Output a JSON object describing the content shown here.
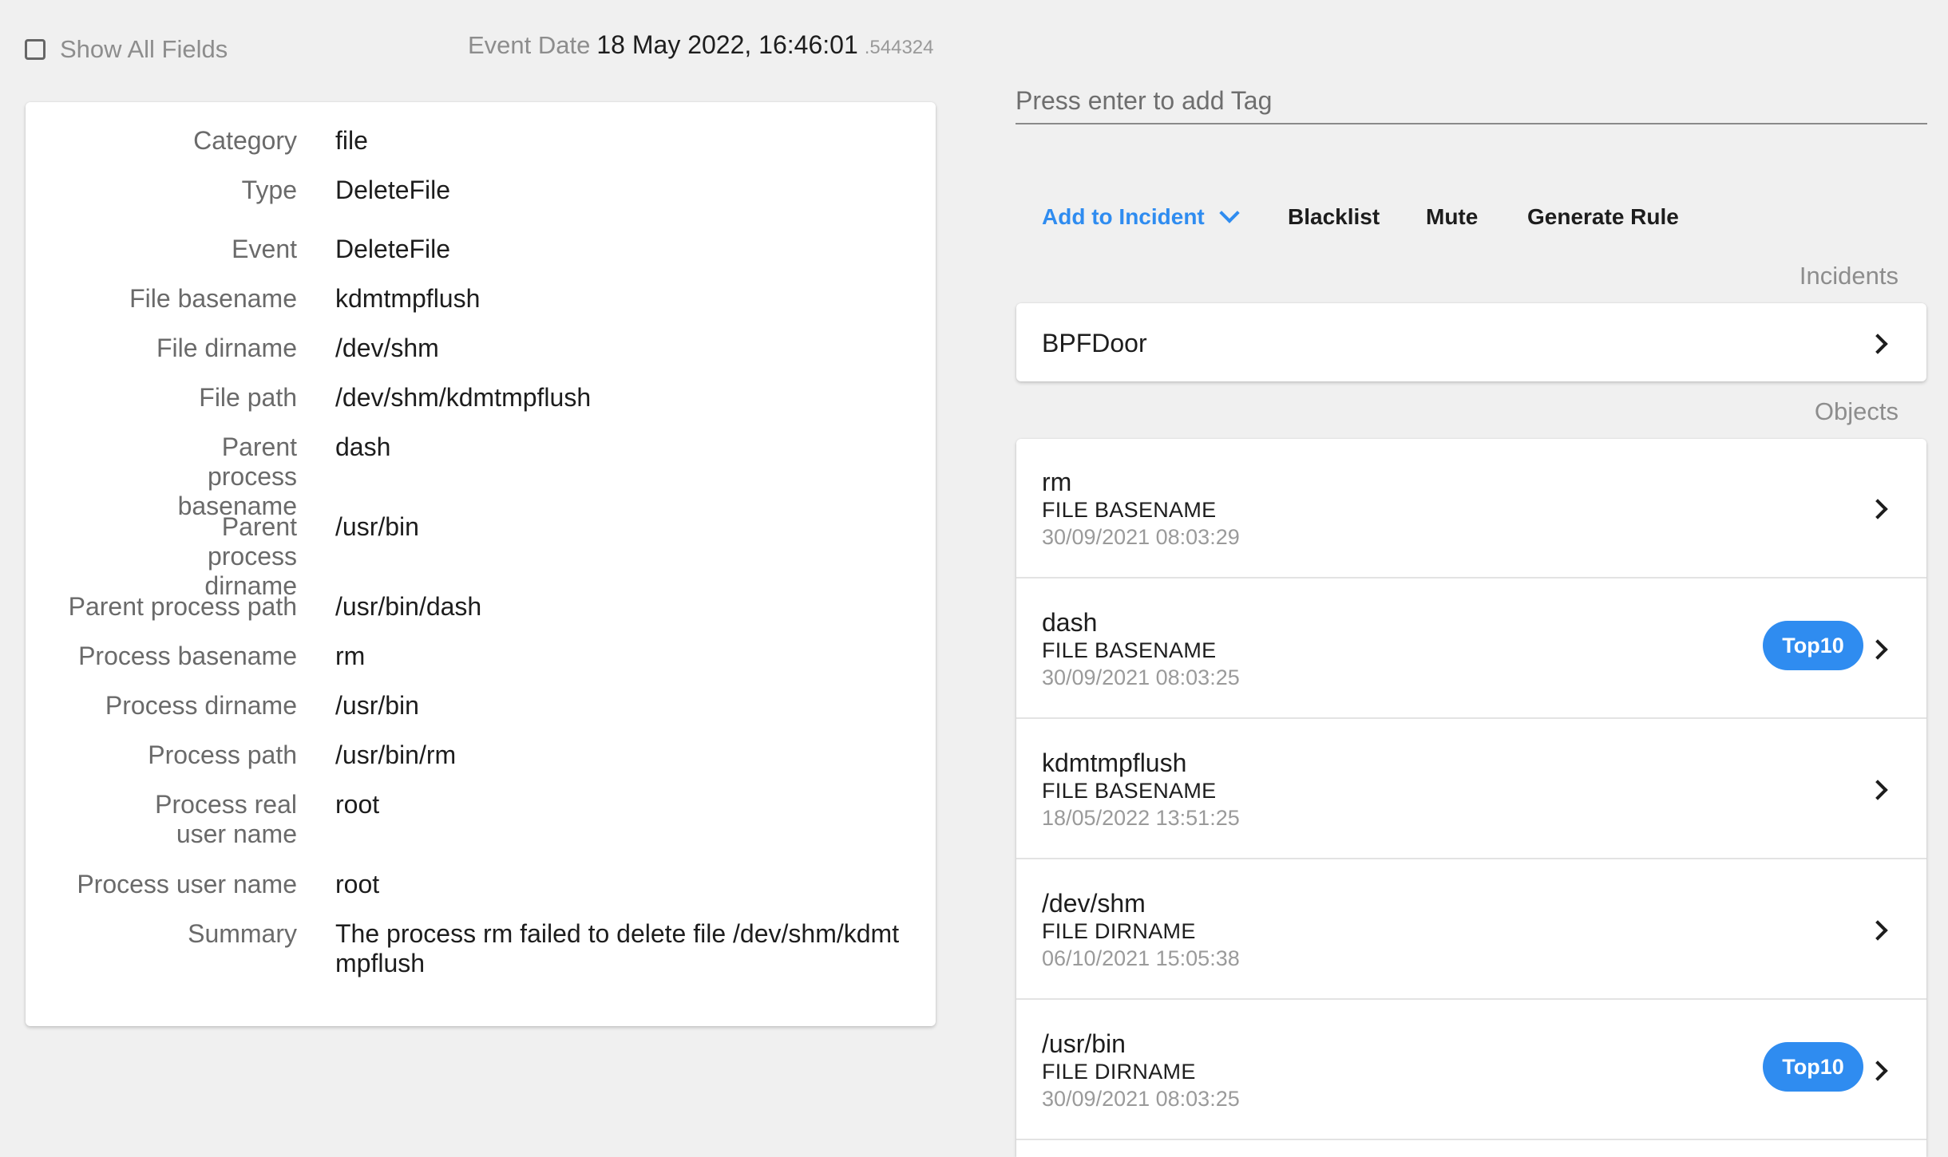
{
  "show_all_fields": {
    "label": "Show All Fields",
    "checked": false
  },
  "event_date": {
    "label": "Event Date",
    "value": "18 May 2022, 16:46:01",
    "fraction": ".544324"
  },
  "details": [
    {
      "label": "Category",
      "value": "file"
    },
    {
      "label": "Type",
      "value": "DeleteFile"
    },
    {
      "label": "Event",
      "value": "DeleteFile"
    },
    {
      "label": "File basename",
      "value": "kdmtmpflush"
    },
    {
      "label": "File dirname",
      "value": "/dev/shm"
    },
    {
      "label": "File path",
      "value": "/dev/shm/kdmtmpflush"
    },
    {
      "label": "Parent process basename",
      "value": "dash"
    },
    {
      "label": "Parent process dirname",
      "value": "/usr/bin"
    },
    {
      "label": "Parent process path",
      "value": "/usr/bin/dash"
    },
    {
      "label": "Process basename",
      "value": "rm"
    },
    {
      "label": "Process dirname",
      "value": "/usr/bin"
    },
    {
      "label": "Process path",
      "value": "/usr/bin/rm"
    },
    {
      "label": "Process real user name",
      "value": "root"
    },
    {
      "label": "Process user name",
      "value": "root"
    },
    {
      "label": "Summary",
      "value": "The process rm failed to delete file /dev/shm/kdmtmpflush"
    }
  ],
  "tag_input": {
    "placeholder": "Press enter to add Tag",
    "value": ""
  },
  "actions": {
    "add_to_incident": "Add to Incident",
    "blacklist": "Blacklist",
    "mute": "Mute",
    "generate_rule": "Generate Rule"
  },
  "incidents": {
    "title": "Incidents",
    "items": [
      {
        "name": "BPFDoor"
      }
    ]
  },
  "objects": {
    "title": "Objects",
    "items": [
      {
        "name": "rm",
        "kind": "FILE BASENAME",
        "date": "30/09/2021 08:03:29",
        "badge": ""
      },
      {
        "name": "dash",
        "kind": "FILE BASENAME",
        "date": "30/09/2021 08:03:25",
        "badge": "Top10"
      },
      {
        "name": "kdmtmpflush",
        "kind": "FILE BASENAME",
        "date": "18/05/2022 13:51:25",
        "badge": ""
      },
      {
        "name": "/dev/shm",
        "kind": "FILE DIRNAME",
        "date": "06/10/2021 15:05:38",
        "badge": ""
      },
      {
        "name": "/usr/bin",
        "kind": "FILE DIRNAME",
        "date": "30/09/2021 08:03:25",
        "badge": "Top10"
      }
    ]
  },
  "colors": {
    "accent": "#2f8cf0",
    "background": "#f0f0f0",
    "card": "#ffffff"
  }
}
